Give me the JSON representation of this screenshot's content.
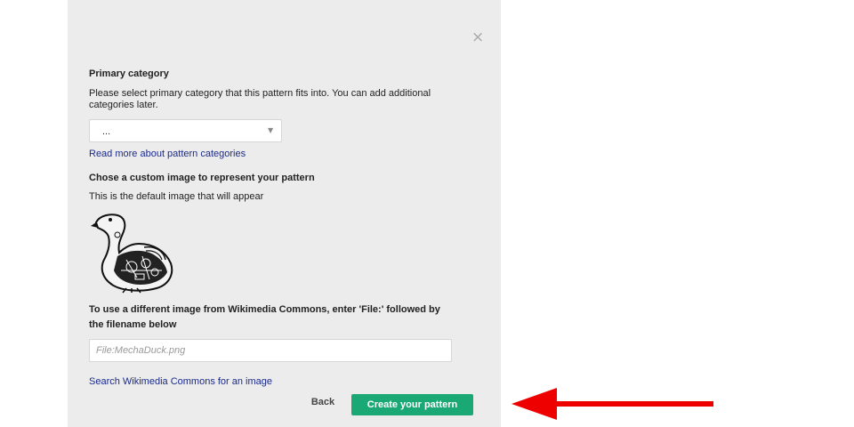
{
  "dialog": {
    "close_glyph": "×",
    "primary_category": {
      "heading": "Primary category",
      "description_line1": "Please select primary category that this pattern fits into. You can add additional",
      "description_line2": "categories later.",
      "select_value": "...",
      "select_caret": "▼",
      "read_more_link": "Read more about pattern categories"
    },
    "custom_image": {
      "heading": "Chose a custom image to represent your pattern",
      "default_note": "This is the default image that will appear",
      "image_icon": "mecha-duck-illustration"
    },
    "different_image": {
      "heading_line1": "To use a different image from Wikimedia Commons, enter 'File:' followed by",
      "heading_line2": "the filename below",
      "file_placeholder": "File:MechaDuck.png",
      "search_link": "Search Wikimedia Commons for an image"
    },
    "actions": {
      "back_label": "Back",
      "create_label": "Create your pattern",
      "create_color": "#1aa974"
    }
  },
  "annotation": {
    "arrow_color": "#ee0000"
  }
}
